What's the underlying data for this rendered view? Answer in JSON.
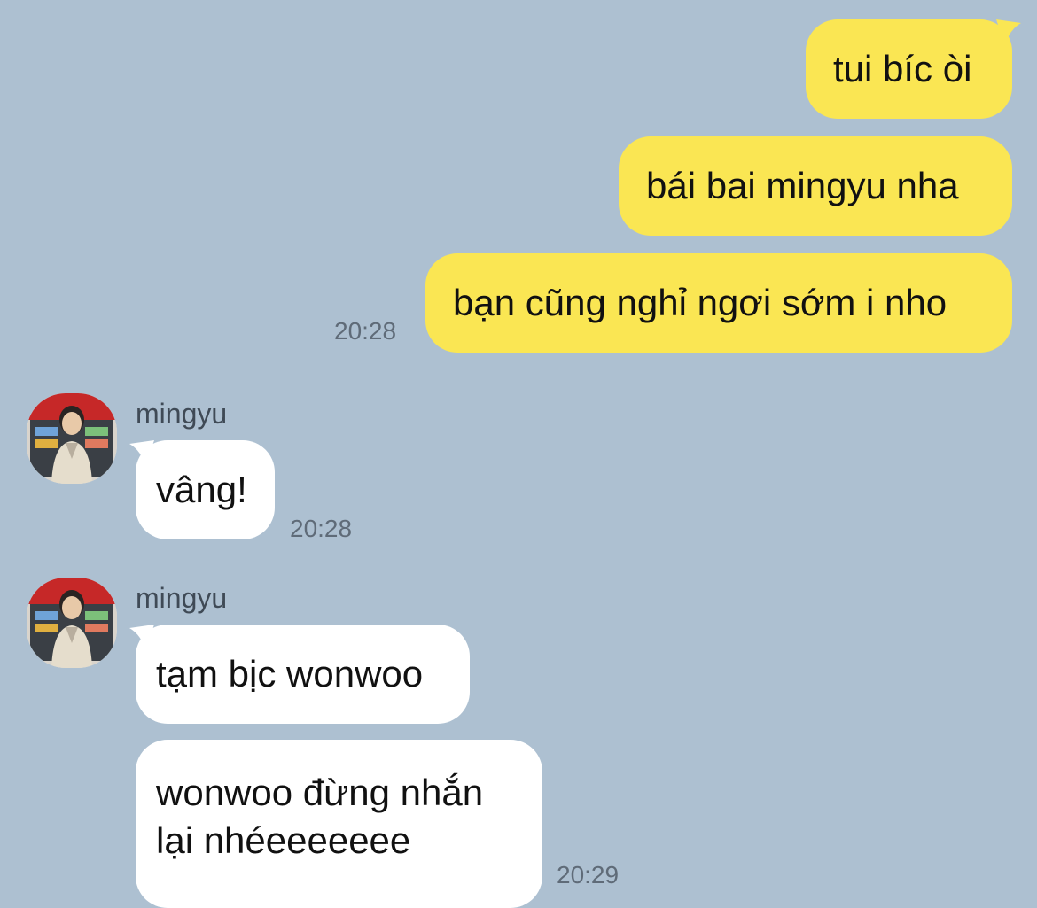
{
  "colors": {
    "background": "#adc0d1",
    "my_bubble": "#fae653",
    "their_bubble": "#ffffff",
    "timestamp": "#5f6b78"
  },
  "outgoing": {
    "messages": [
      "tui bíc òi",
      "bái bai mingyu nha",
      "bạn cũng nghỉ ngơi sớm i nho"
    ],
    "time": "20:28"
  },
  "incoming": [
    {
      "sender": "mingyu",
      "avatar": "avatar-photo",
      "messages": [
        "vâng!"
      ],
      "time": "20:28"
    },
    {
      "sender": "mingyu",
      "avatar": "avatar-photo",
      "messages": [
        "tạm bịc wonwoo",
        "wonwoo đừng nhắn lại nhéeeeeeee"
      ],
      "time": "20:29"
    }
  ]
}
